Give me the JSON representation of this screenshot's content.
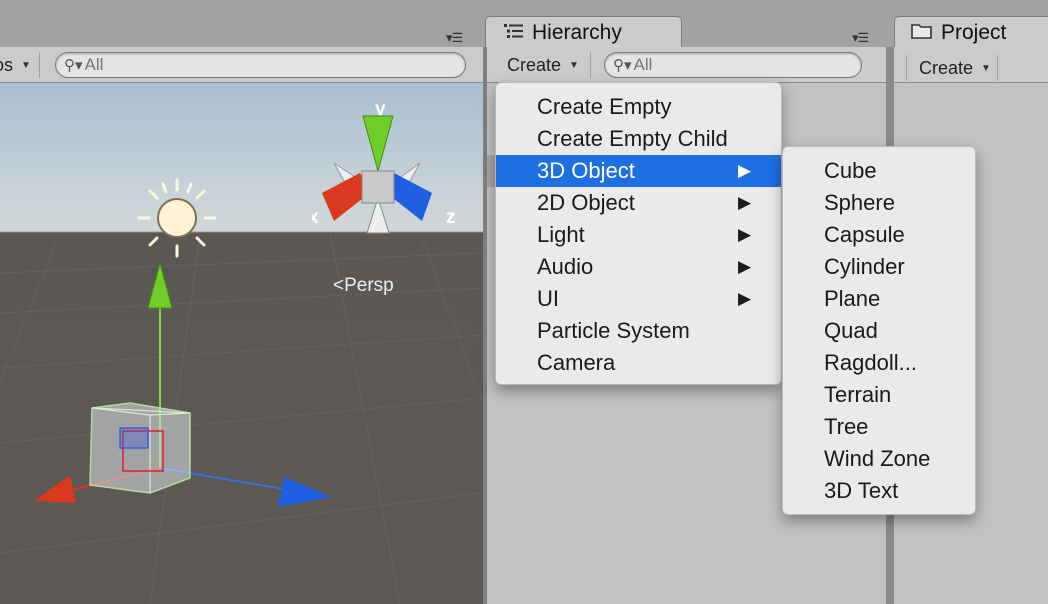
{
  "scene": {
    "gizmos_tab_fragment": "os",
    "search_placeholder": "All",
    "axis_labels": {
      "x": "x",
      "y": "y",
      "z": "z"
    },
    "view_mode": "Persp"
  },
  "hierarchy": {
    "tab_title": "Hierarchy",
    "create_label": "Create",
    "search_placeholder": "All"
  },
  "project": {
    "tab_title": "Project",
    "create_label": "Create"
  },
  "create_menu": {
    "items": [
      {
        "label": "Create Empty"
      },
      {
        "label": "Create Empty Child"
      },
      {
        "label": "3D Object",
        "submenu": true,
        "selected": true
      },
      {
        "label": "2D Object",
        "submenu": true
      },
      {
        "label": "Light",
        "submenu": true
      },
      {
        "label": "Audio",
        "submenu": true
      },
      {
        "label": "UI",
        "submenu": true
      },
      {
        "label": "Particle System"
      },
      {
        "label": "Camera"
      }
    ]
  },
  "submenu_3d_object": {
    "items": [
      "Cube",
      "Sphere",
      "Capsule",
      "Cylinder",
      "Plane",
      "Quad",
      "Ragdoll...",
      "Terrain",
      "Tree",
      "Wind Zone",
      "3D Text"
    ]
  },
  "colors": {
    "selection": "#1e6fe0",
    "axis_x": "#d8391f",
    "axis_y": "#6fcf2a",
    "axis_z": "#1f5fe0"
  },
  "icons": {
    "hierarchy_tab": "list-icon",
    "project_tab": "folder-icon",
    "submenu": "triangle-right-icon",
    "search": "magnifier-icon"
  }
}
